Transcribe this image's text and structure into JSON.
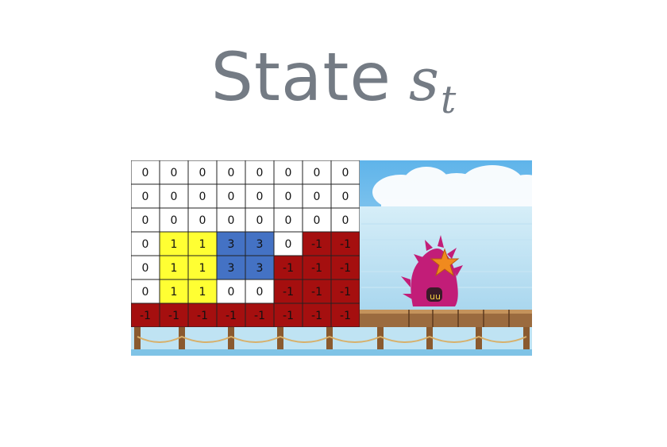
{
  "title": {
    "word": "State",
    "symbol": "s",
    "subscript": "t"
  },
  "grid": {
    "rows": [
      [
        "0",
        "0",
        "0",
        "0",
        "0",
        "0",
        "0",
        "0"
      ],
      [
        "0",
        "0",
        "0",
        "0",
        "0",
        "0",
        "0",
        "0"
      ],
      [
        "0",
        "0",
        "0",
        "0",
        "0",
        "0",
        "0",
        "0"
      ],
      [
        "0",
        "1",
        "1",
        "3",
        "3",
        "0",
        "-1",
        "-1"
      ],
      [
        "0",
        "1",
        "1",
        "3",
        "3",
        "-1",
        "-1",
        "-1"
      ],
      [
        "0",
        "1",
        "1",
        "0",
        "0",
        "-1",
        "-1",
        "-1"
      ],
      [
        "-1",
        "-1",
        "-1",
        "-1",
        "-1",
        "-1",
        "-1",
        "-1"
      ]
    ],
    "colors": {
      "0": "#ffffff",
      "1": "#ffff33",
      "3": "#4472c4",
      "-1": "#a50f0f"
    }
  },
  "scene": {
    "sky_color": "#8fc8e8",
    "sea_color": "#b6ddf0",
    "bridge_color": "#9b6b3f",
    "character_color": "#c21d78",
    "star_color": "#f08a1e"
  }
}
